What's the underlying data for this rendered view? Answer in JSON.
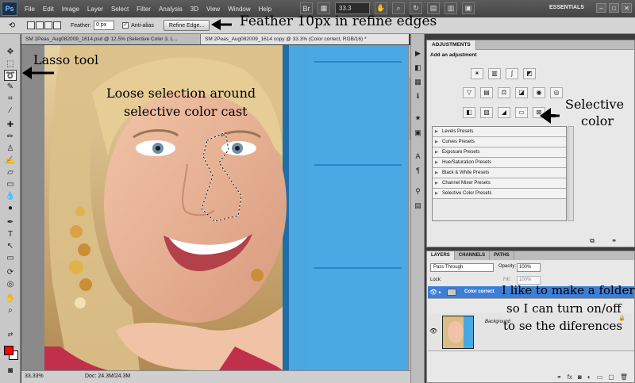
{
  "menubar": {
    "logo": "Ps",
    "items": [
      "File",
      "Edit",
      "Image",
      "Layer",
      "Select",
      "Filter",
      "Analysis",
      "3D",
      "View",
      "Window",
      "Help"
    ],
    "zoom": "33.3",
    "workspace": "ESSENTIALS"
  },
  "options": {
    "feather_label": "Feather:",
    "feather_value": "0 px",
    "antialias_label": "Anti-alias",
    "refine_button": "Refine Edge..."
  },
  "tabs": [
    "SM 2Peas_Aug082009_1614.psd @ 12.5% (Selective Color 3, L...",
    "SM 2Peas_Aug082009_1614 copy @ 33.3% (Color correct, RGB/16) *"
  ],
  "status": {
    "zoom": "33.33%",
    "doc": "Doc: 24.3M/24.3M"
  },
  "adjustments": {
    "tab": "ADJUSTMENTS",
    "title": "Add an adjustment",
    "presets": [
      "Levels Presets",
      "Curves Presets",
      "Exposure Presets",
      "Hue/Saturation Presets",
      "Black & White Presets",
      "Channel Mixer Presets",
      "Selective Color Presets"
    ]
  },
  "layers": {
    "tabs": [
      "LAYERS",
      "CHANNELS",
      "PATHS"
    ],
    "blend_mode": "Pass Through",
    "opacity_label": "Opacity:",
    "opacity_value": "100%",
    "lock_label": "Lock:",
    "fill_label": "Fill:",
    "fill_value": "100%",
    "items": [
      {
        "name": "Color correct"
      },
      {
        "name": "Background"
      }
    ]
  },
  "annotations": {
    "feather": "Feather 10px in refine edges",
    "lasso": "Lasso tool",
    "selection_1": "Loose selection around",
    "selection_2": "selective color cast",
    "selective_1": "Selective",
    "selective_2": "color",
    "folder_1": "I like to make a folder",
    "folder_2": "so I can turn on/off",
    "folder_3": "to se the diferences"
  },
  "colors": {
    "foreground": "#ff0000",
    "background": "#ffffff",
    "selected_layer": "#3d7fd6"
  }
}
